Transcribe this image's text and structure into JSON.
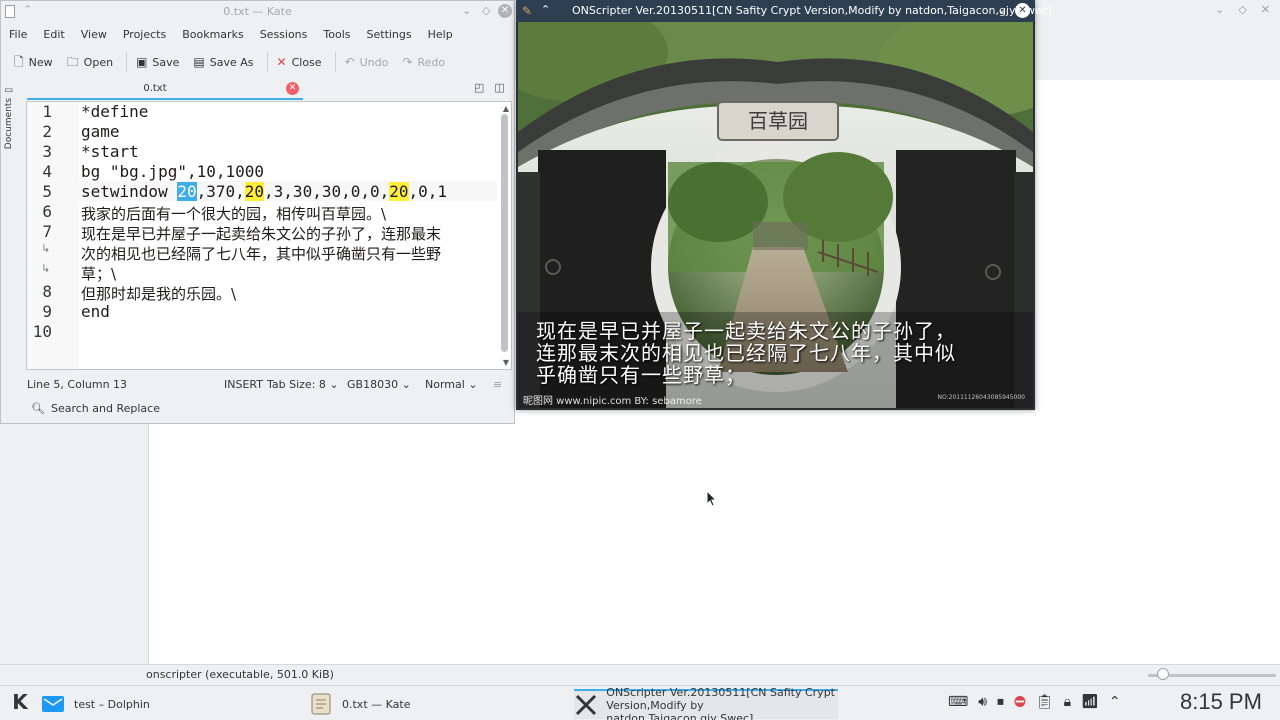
{
  "dolphin": {
    "statusbar_text": "onscripter (executable, 501.0 KiB)"
  },
  "kate": {
    "window_title": "0.txt  — Kate",
    "menu": [
      "File",
      "Edit",
      "View",
      "Projects",
      "Bookmarks",
      "Sessions",
      "Tools",
      "Settings",
      "Help"
    ],
    "toolbar": {
      "new": "New",
      "open": "Open",
      "save": "Save",
      "save_as": "Save As",
      "close": "Close",
      "undo": "Undo",
      "redo": "Redo"
    },
    "side_panel_label": "Documents",
    "tab_label": "0.txt",
    "lines": {
      "l1": "*define",
      "l2": "game",
      "l3": "*start",
      "l4": "bg \"bg.jpg\",10,1000",
      "l5_a": "setwindow ",
      "l5_sel": "20",
      "l5_b": ",370,",
      "l5_m1": "20",
      "l5_c": ",3,30,30,0,0,",
      "l5_m2": "20",
      "l5_d": ",0,1",
      "l6": "我家的后面有一个很大的园，相传叫百草园。\\",
      "l7_a": "现在是早已并屋子一起卖给朱文公的子孙了，连那最末",
      "l7_b": "次的相见也已经隔了七八年，其中似乎确凿只有一些野",
      "l7_c": "草；\\",
      "l8": "但那时却是我的乐园。\\",
      "l9": "end"
    },
    "line_numbers": [
      "1",
      "2",
      "3",
      "4",
      "5",
      "6",
      "7",
      "8",
      "9",
      "10"
    ],
    "status": {
      "cursor": "Line 5, Column 13",
      "mode": "INSERT",
      "tab_size": "Tab Size: 8",
      "encoding": "GB18030",
      "input_mode": "Normal"
    },
    "search_replace": "Search and Replace"
  },
  "onscripter": {
    "window_title": "ONScripter Ver.20130511[CN Safity Crypt Version,Modify by natdon,Taigacon,gjy,Swec]",
    "caption_1": "现在是早已并屋子一起卖给朱文公的子孙了，",
    "caption_2": "连那最末次的相见也已经隔了七八年，其中似",
    "caption_3": "乎确凿只有一些野草；",
    "gate_sign": "百草园",
    "watermark": "昵图网 www.nipic.com   BY: sebamore",
    "watermark_id": "NO:20111126043085945000"
  },
  "taskbar": {
    "tasks": [
      {
        "label": "test – Dolphin"
      },
      {
        "label": "0.txt  — Kate"
      },
      {
        "label_1": "ONScripter Ver.20130511[CN Safity Crypt",
        "label_2": "Version,Modify by natdon,Taigacon,gjy,Swec]"
      }
    ],
    "clock": "8:15 PM"
  },
  "colors": {
    "accent": "#3daee9",
    "match_highlight": "#ffef3b",
    "ons_titlebar": "#2c3e50",
    "close_red": "#f25f68"
  }
}
